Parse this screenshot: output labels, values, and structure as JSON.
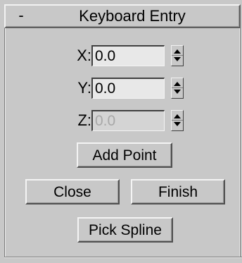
{
  "rollout": {
    "toggle_symbol": "-",
    "title": "Keyboard Entry"
  },
  "fields": [
    {
      "label": "X:",
      "value": "0.0",
      "enabled": true
    },
    {
      "label": "Y:",
      "value": "0.0",
      "enabled": true
    },
    {
      "label": "Z:",
      "value": "0.0",
      "enabled": false
    }
  ],
  "buttons": {
    "add_point": "Add Point",
    "close": "Close",
    "finish": "Finish",
    "pick_spline": "Pick Spline"
  },
  "icons": {
    "spinner_up": "triangle-up-icon",
    "spinner_down": "triangle-down-icon"
  }
}
